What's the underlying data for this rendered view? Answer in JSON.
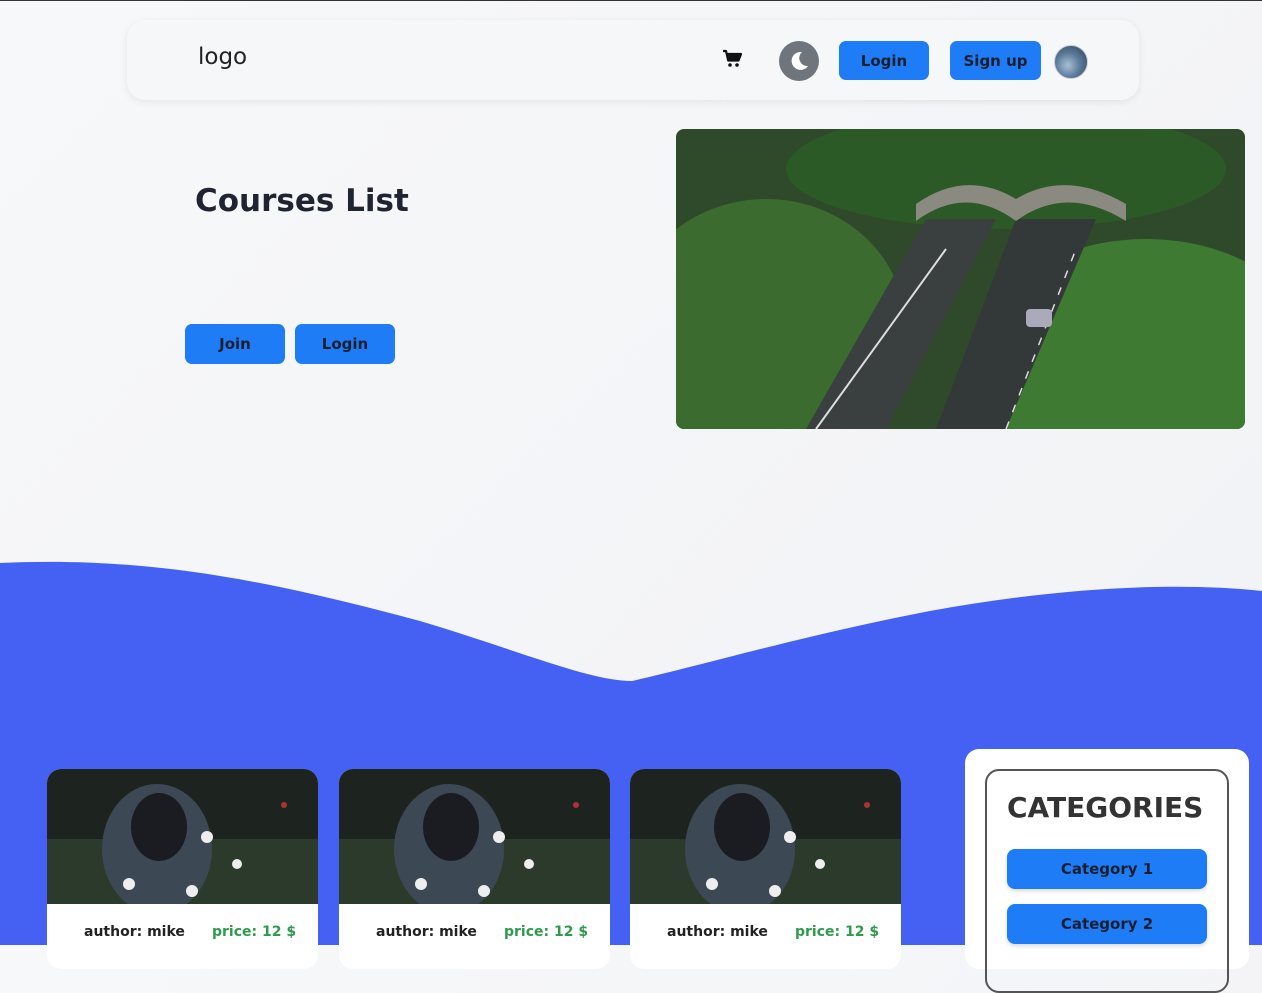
{
  "header": {
    "logo": "logo",
    "login_label": "Login",
    "signup_label": "Sign up"
  },
  "hero": {
    "title": "Courses List",
    "join_label": "Join",
    "login_label": "Login"
  },
  "courses": [
    {
      "author": "author: mike",
      "price": "price: 12 $"
    },
    {
      "author": "author: mike",
      "price": "price: 12 $"
    },
    {
      "author": "author: mike",
      "price": "price: 12 $"
    }
  ],
  "categories": {
    "title": "CATEGORIES",
    "items": [
      "Category 1",
      "Category 2"
    ]
  },
  "colors": {
    "accent": "#1e7cf7",
    "wave": "#4461f4",
    "price": "#2e9b4c"
  },
  "icons": [
    "cart-icon",
    "moon-icon",
    "avatar"
  ]
}
